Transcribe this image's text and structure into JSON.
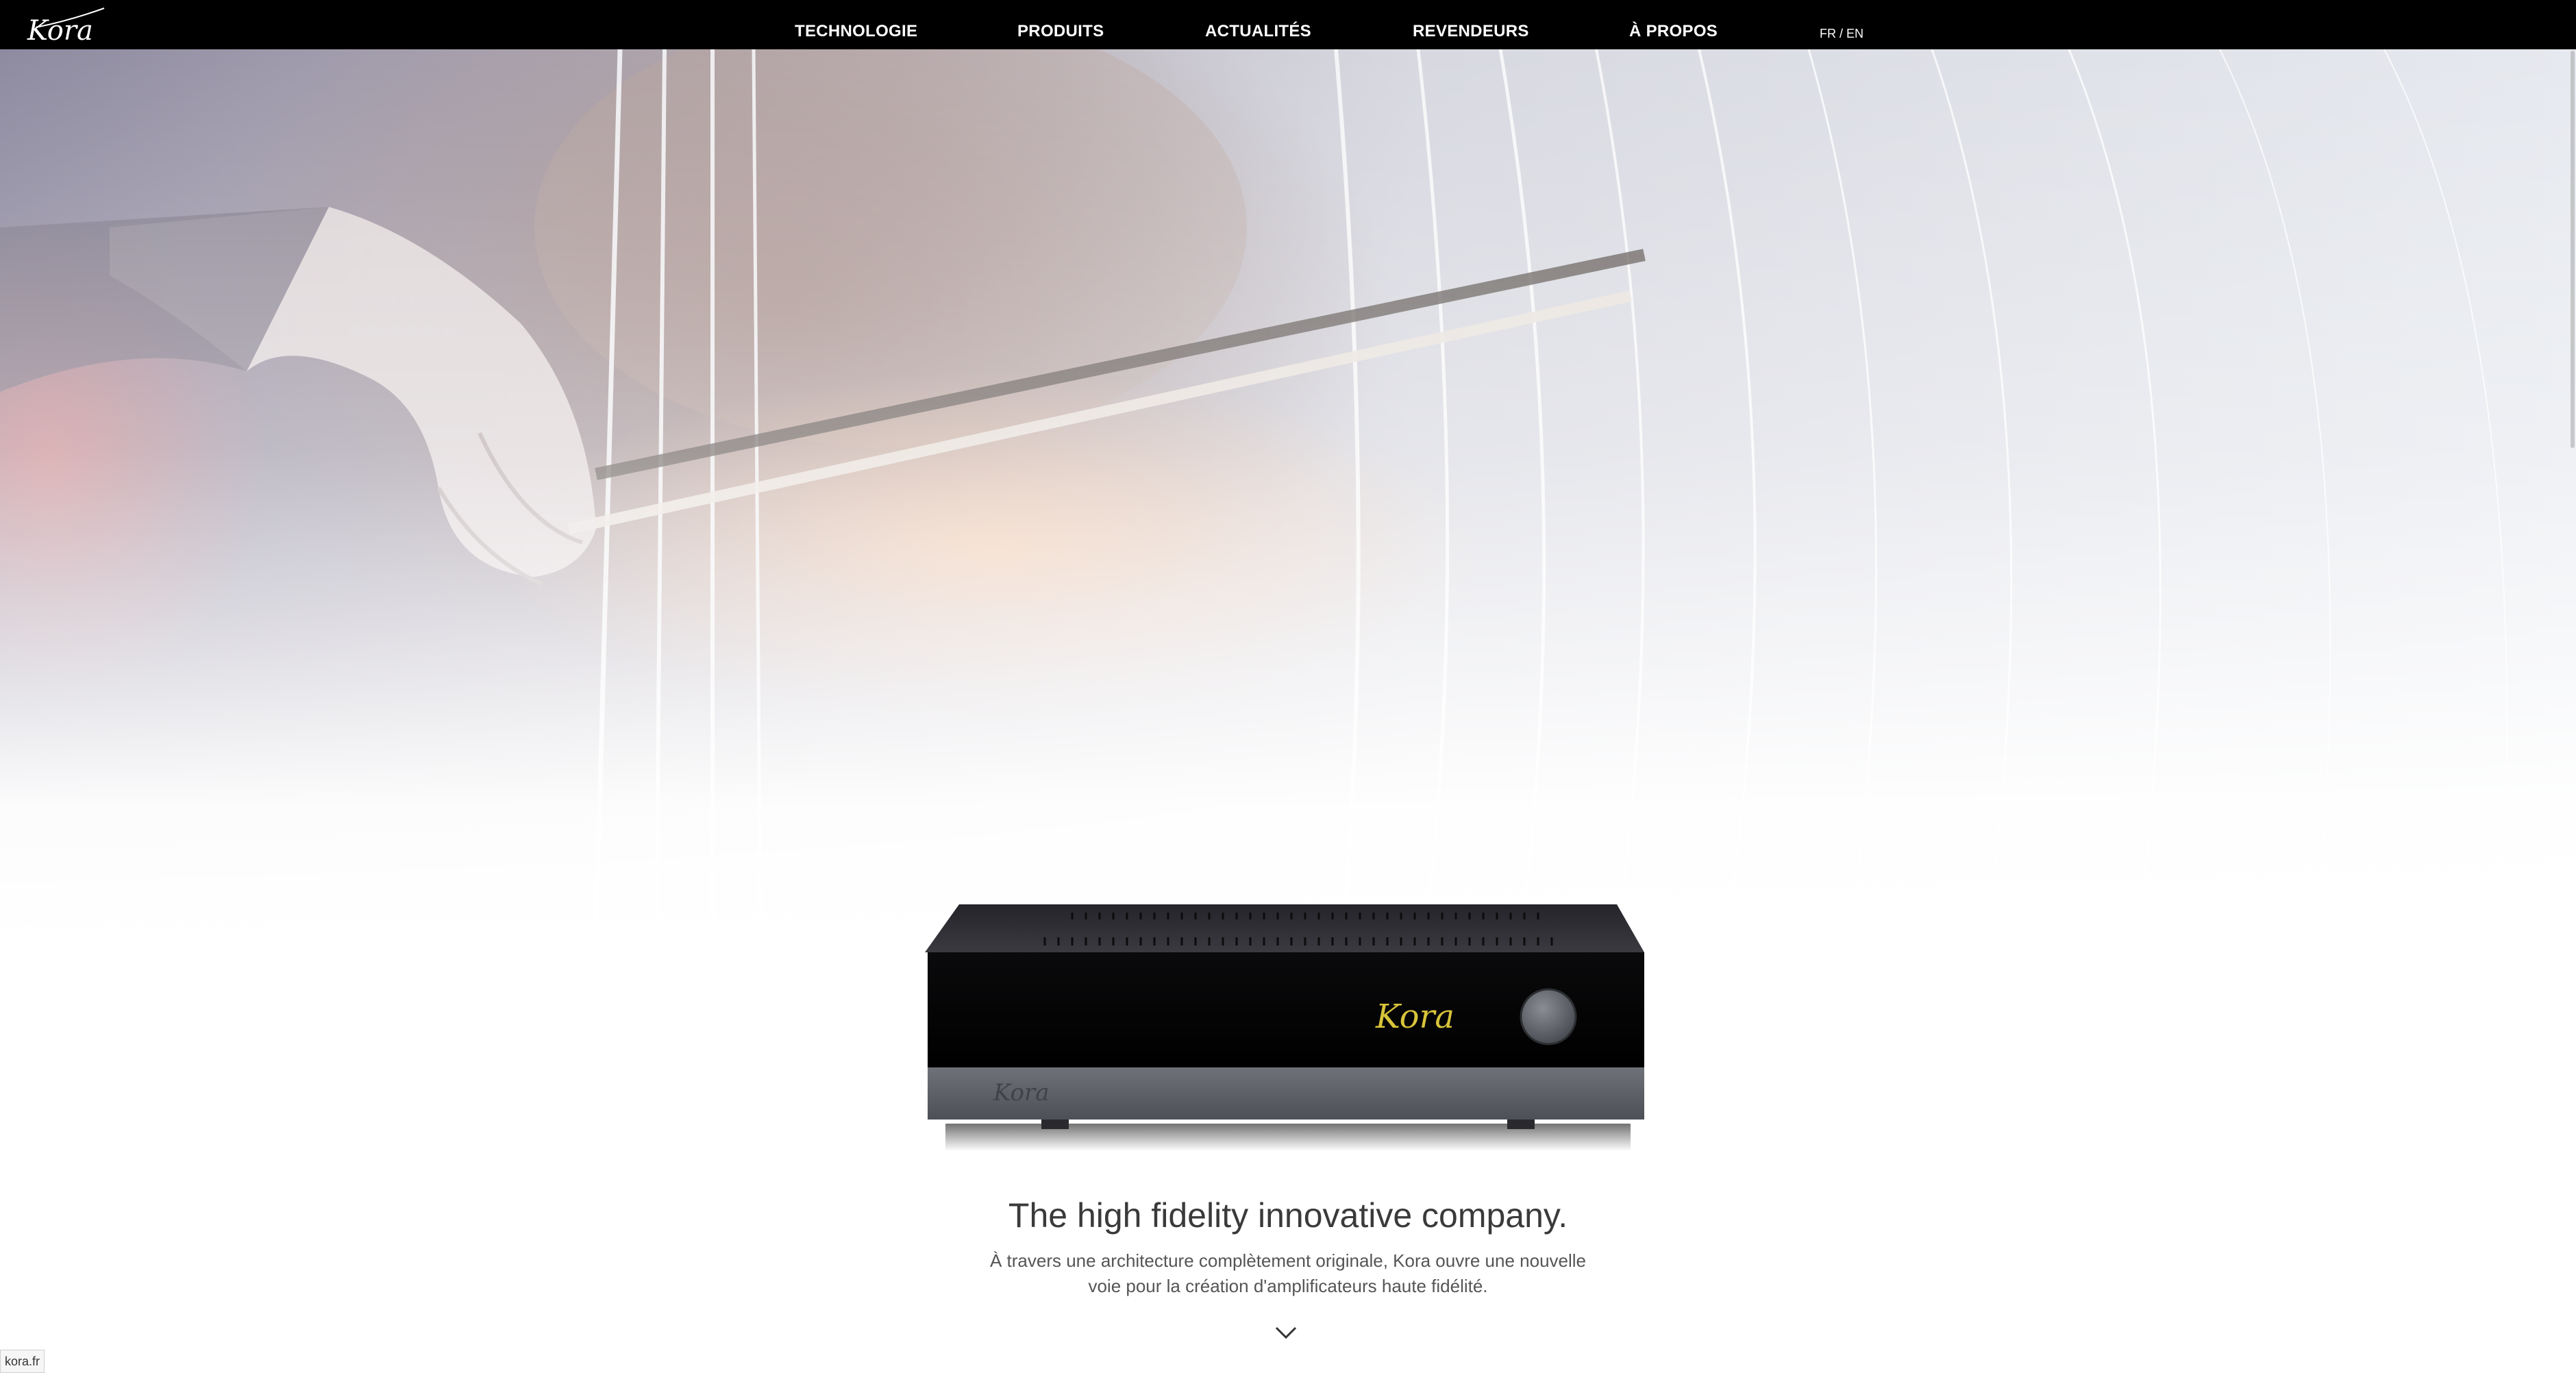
{
  "header": {
    "logo_text": "Kora",
    "nav": [
      {
        "label": "TECHNOLOGIE"
      },
      {
        "label": "PRODUITS"
      },
      {
        "label": "ACTUALITÉS"
      },
      {
        "label": "REVENDEURS"
      },
      {
        "label": "À PROPOS"
      }
    ],
    "lang": {
      "fr": "FR",
      "separator": " / ",
      "en": "EN"
    }
  },
  "hero": {
    "product_logo_text": "Kora",
    "product_base_logo_text": "Kora"
  },
  "intro": {
    "headline": "The high fidelity innovative company.",
    "lead": "À travers une architecture complètement originale, Kora ouvre une nouvelle voie pour la création d'amplificateurs haute fidélité."
  },
  "status_bar": {
    "url": "kora.fr"
  },
  "colors": {
    "nav_bg": "#000000",
    "nav_text": "#ffffff",
    "headline": "#3a3a3a",
    "body_text": "#555555",
    "product_logo": "#d8c43a"
  },
  "icons": {
    "scroll_down": "chevron-down-icon",
    "logo": "kora-logo-icon"
  }
}
